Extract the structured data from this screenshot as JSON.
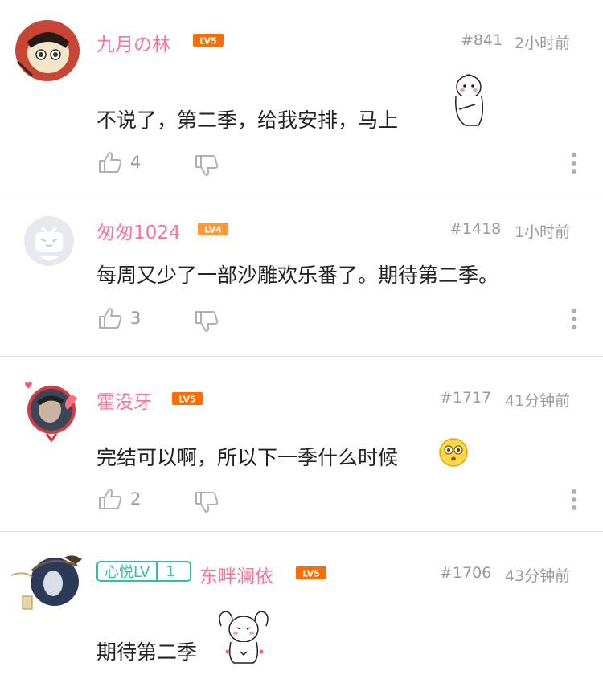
{
  "comments": [
    {
      "username": "九月の林",
      "level": "LV5",
      "floor": "#841",
      "time": "2小时前",
      "content": "不说了，第二季，给我安排，马上",
      "likes": "4"
    },
    {
      "username": "匆匆1024",
      "level": "LV4",
      "floor": "#1418",
      "time": "1小时前",
      "content": "每周又少了一部沙雕欢乐番了。期待第二季。",
      "likes": "3"
    },
    {
      "username": "霍没牙",
      "level": "LV5",
      "floor": "#1717",
      "time": "41分钟前",
      "content": "完结可以啊，所以下一季什么时候",
      "likes": "2"
    },
    {
      "username": "东畔澜依",
      "level": "LV5",
      "fan_badge": {
        "name": "心悦LV",
        "level": "1"
      },
      "floor": "#1706",
      "time": "43分钟前",
      "content": "期待第二季"
    }
  ],
  "colors": {
    "username": "#fb7299",
    "lv5": "#ff6c00",
    "lv4": "#ff9a3c",
    "fan_badge": "#2dbfa8",
    "meta": "#9a9a9a"
  },
  "icons": [
    "like-icon",
    "dislike-icon",
    "more-icon",
    "sticker-icon",
    "emoji-icon"
  ]
}
